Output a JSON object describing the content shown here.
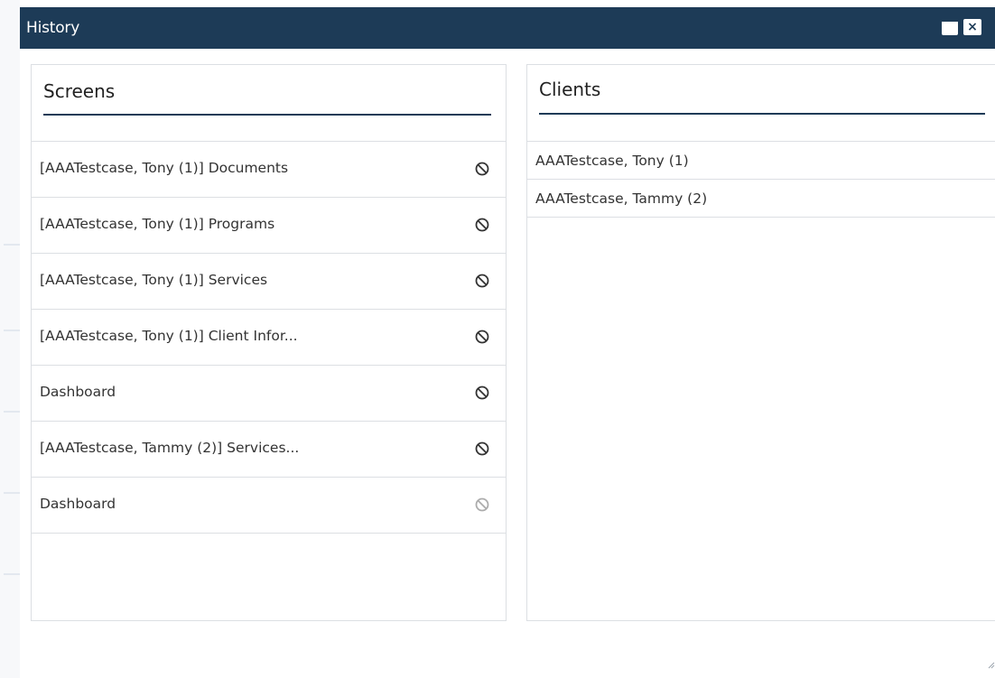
{
  "dialog": {
    "title": "History",
    "minimize_icon": "minimize-icon",
    "close_icon": "close-icon",
    "close_glyph": "×"
  },
  "screens": {
    "title": "Screens",
    "items": [
      {
        "label": "[AAATestcase, Tony (1)] Documents",
        "icon": "block-icon",
        "enabled": true
      },
      {
        "label": "[AAATestcase, Tony (1)] Programs",
        "icon": "block-icon",
        "enabled": true
      },
      {
        "label": "[AAATestcase, Tony (1)] Services",
        "icon": "block-icon",
        "enabled": true
      },
      {
        "label": "[AAATestcase, Tony (1)] Client Infor...",
        "icon": "block-icon",
        "enabled": true
      },
      {
        "label": "Dashboard",
        "icon": "block-icon",
        "enabled": true
      },
      {
        "label": "[AAATestcase, Tammy (2)] Services...",
        "icon": "block-icon",
        "enabled": true
      },
      {
        "label": "Dashboard",
        "icon": "block-icon",
        "enabled": false
      }
    ]
  },
  "clients": {
    "title": "Clients",
    "items": [
      {
        "label": "AAATestcase, Tony (1)"
      },
      {
        "label": "AAATestcase, Tammy (2)"
      }
    ]
  },
  "colors": {
    "titlebar": "#1d3b57",
    "rule": "#1d3b57",
    "border": "#dcdfe3"
  }
}
